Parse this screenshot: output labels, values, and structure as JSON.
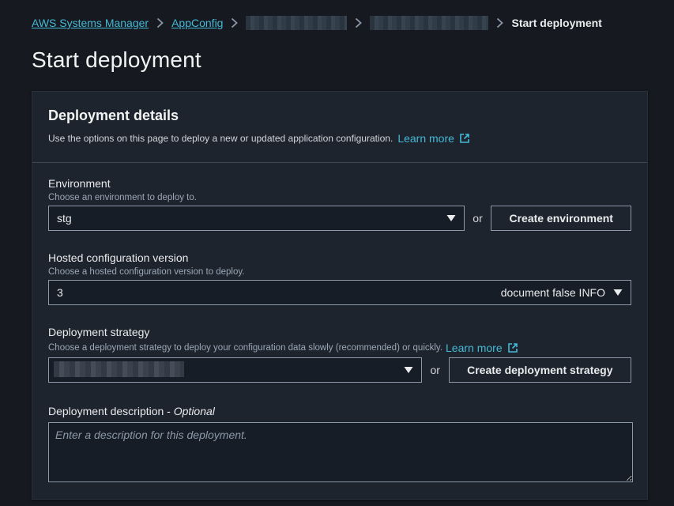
{
  "breadcrumb": {
    "items": [
      "AWS Systems Manager",
      "AppConfig"
    ],
    "current": "Start deployment"
  },
  "page": {
    "title": "Start deployment"
  },
  "panel": {
    "title": "Deployment details",
    "description": "Use the options on this page to deploy a new or updated application configuration.",
    "learn_more": "Learn more"
  },
  "environment": {
    "label": "Environment",
    "hint": "Choose an environment to deploy to.",
    "selected": "stg",
    "or": "or",
    "create_button": "Create environment"
  },
  "hosted_version": {
    "label": "Hosted configuration version",
    "hint": "Choose a hosted configuration version to deploy.",
    "selected": "3",
    "detail": "document false INFO"
  },
  "strategy": {
    "label": "Deployment strategy",
    "hint": "Choose a deployment strategy to deploy your configuration data slowly (recommended) or quickly.",
    "learn_more": "Learn more",
    "or": "or",
    "create_button": "Create deployment strategy"
  },
  "description_field": {
    "label": "Deployment description",
    "optional": "Optional",
    "separator": " - ",
    "placeholder": "Enter a description for this deployment."
  },
  "colors": {
    "link": "#44b9d6",
    "background": "#16191f",
    "panel": "#1e242d",
    "border": "#8d99a8"
  },
  "icons": {
    "separator": "chevron-right-icon",
    "external": "external-link-icon",
    "dropdown": "caret-down-icon"
  }
}
